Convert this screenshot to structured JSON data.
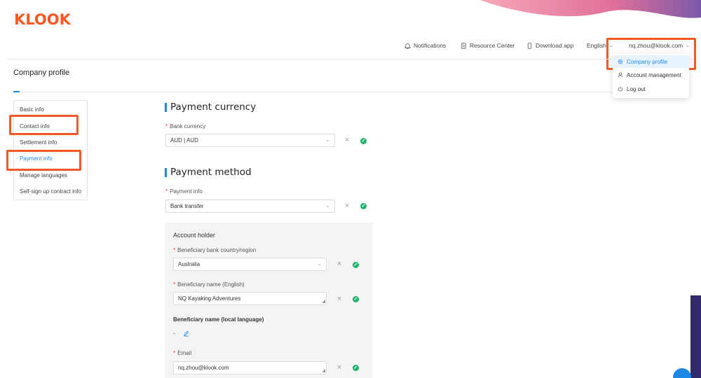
{
  "brand": {
    "logo": "KLOOK",
    "accent": "#ff5722",
    "primary": "#1e88e5"
  },
  "topnav": {
    "notifications": "Notifications",
    "resource_center": "Resource Center",
    "download_app": "Download app",
    "language": "English",
    "user_email": "nq.zhou@klook.com"
  },
  "user_menu": {
    "items": [
      {
        "label": "Company profile",
        "icon": "settings-icon",
        "active": true
      },
      {
        "label": "Account management",
        "icon": "user-icon",
        "active": false
      },
      {
        "label": "Log out",
        "icon": "power-icon",
        "active": false
      }
    ]
  },
  "page": {
    "title": "Company profile"
  },
  "sidebar": {
    "items": [
      {
        "label": "Basic info"
      },
      {
        "label": "Contact info"
      },
      {
        "label": "Settlement info"
      },
      {
        "label": "Payment info",
        "active": true
      },
      {
        "label": "Manage languages"
      },
      {
        "label": "Self-sign up contract info"
      }
    ]
  },
  "payment_currency": {
    "title": "Payment currency",
    "bank_currency_label": "Bank currency",
    "bank_currency_value": "AUD | AUD"
  },
  "payment_method": {
    "title": "Payment method",
    "payment_info_label": "Payment info",
    "payment_info_value": "Bank transfer"
  },
  "account_holder": {
    "title": "Account holder",
    "country_label": "Beneficiary bank country/region",
    "country_value": "Australia",
    "name_en_label": "Beneficiary name (English)",
    "name_en_value": "NQ Kayaking Adventures",
    "name_local_label": "Beneficiary name (local language)",
    "name_local_value": "-",
    "email_label": "Email",
    "email_value": "nq.zhou@klook.com"
  }
}
